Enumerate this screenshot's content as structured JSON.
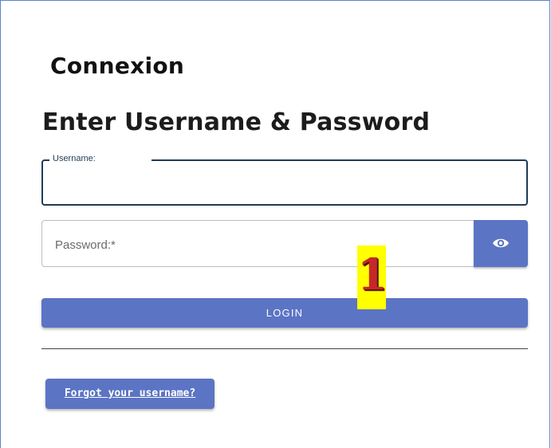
{
  "header": {
    "title": "Connexion",
    "subtitle": "Enter Username & Password"
  },
  "form": {
    "username_label": "Username:",
    "username_value": "",
    "password_placeholder": "Password:*",
    "password_value": "",
    "toggle_visibility_icon": "eye-icon",
    "login_label": "LOGIN"
  },
  "links": {
    "forgot_username": "Forgot your username?"
  },
  "annotation": {
    "number": "1"
  },
  "colors": {
    "primary": "#5b74c4",
    "field_border_focused": "#1f3b55",
    "annotation_bg": "#ffff00",
    "annotation_text": "#c62828"
  }
}
